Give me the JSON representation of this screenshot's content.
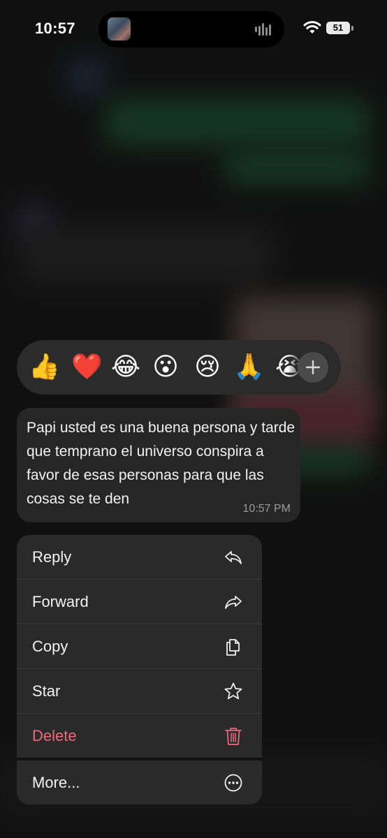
{
  "status_bar": {
    "time": "10:57",
    "battery": "51"
  },
  "reactions": [
    "👍",
    "❤️",
    "😂",
    "😮",
    "😢",
    "🙏",
    "😭"
  ],
  "message": {
    "text": "Papi usted es una buena persona y tarde que temprano el universo conspira a favor de esas personas para que las cosas se te den",
    "time": "10:57 PM"
  },
  "menu": {
    "items": [
      {
        "label": "Reply",
        "icon": "reply-icon"
      },
      {
        "label": "Forward",
        "icon": "forward-icon"
      },
      {
        "label": "Copy",
        "icon": "copy-icon"
      },
      {
        "label": "Star",
        "icon": "star-icon"
      },
      {
        "label": "Delete",
        "icon": "trash-icon"
      },
      {
        "label": "More...",
        "icon": "more-icon"
      }
    ]
  },
  "colors": {
    "danger": "#ea6a7a",
    "menu_bg": "#2a2a2a",
    "bubble_bg": "#262626"
  }
}
